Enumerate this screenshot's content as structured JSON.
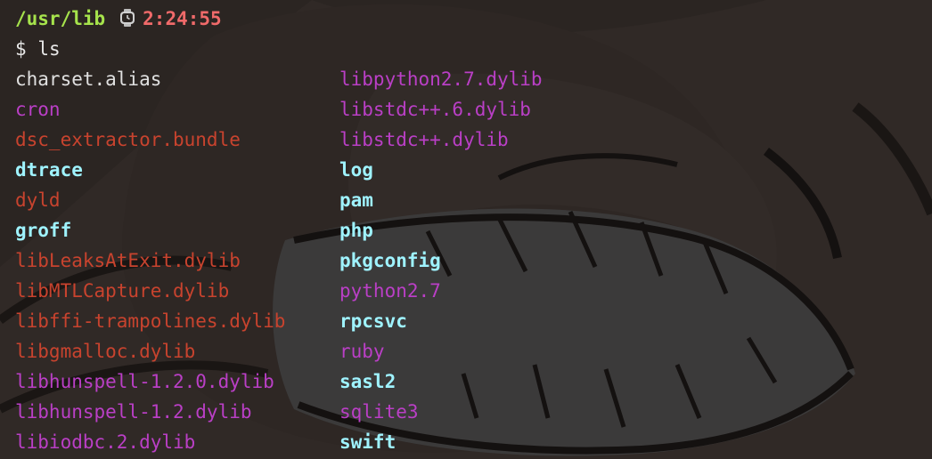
{
  "header": {
    "cwd": "/usr/lib",
    "clock_icon": "watch-icon",
    "time": "2:24:55"
  },
  "command": {
    "prompt": "$",
    "text": "ls"
  },
  "colors": {
    "file": "#e0e0e0",
    "exec": "#ba3fc6",
    "lib": "#c8432e",
    "dir": "#9ff3ff"
  },
  "listing": {
    "col1": [
      {
        "name": "charset.alias",
        "type": "file"
      },
      {
        "name": "cron",
        "type": "exec"
      },
      {
        "name": "dsc_extractor.bundle",
        "type": "lib"
      },
      {
        "name": "dtrace",
        "type": "dir"
      },
      {
        "name": "dyld",
        "type": "lib"
      },
      {
        "name": "groff",
        "type": "dir"
      },
      {
        "name": "libLeaksAtExit.dylib",
        "type": "lib"
      },
      {
        "name": "libMTLCapture.dylib",
        "type": "lib"
      },
      {
        "name": "libffi-trampolines.dylib",
        "type": "lib"
      },
      {
        "name": "libgmalloc.dylib",
        "type": "lib"
      },
      {
        "name": "libhunspell-1.2.0.dylib",
        "type": "exec"
      },
      {
        "name": "libhunspell-1.2.dylib",
        "type": "exec"
      },
      {
        "name": "libiodbc.2.dylib",
        "type": "exec"
      }
    ],
    "col2": [
      {
        "name": "libpython2.7.dylib",
        "type": "exec"
      },
      {
        "name": "libstdc++.6.dylib",
        "type": "exec"
      },
      {
        "name": "libstdc++.dylib",
        "type": "exec"
      },
      {
        "name": "log",
        "type": "dir"
      },
      {
        "name": "pam",
        "type": "dir"
      },
      {
        "name": "php",
        "type": "dir"
      },
      {
        "name": "pkgconfig",
        "type": "dir"
      },
      {
        "name": "python2.7",
        "type": "exec"
      },
      {
        "name": "rpcsvc",
        "type": "dir"
      },
      {
        "name": "ruby",
        "type": "exec"
      },
      {
        "name": "sasl2",
        "type": "dir"
      },
      {
        "name": "sqlite3",
        "type": "exec"
      },
      {
        "name": "swift",
        "type": "dir"
      }
    ]
  }
}
